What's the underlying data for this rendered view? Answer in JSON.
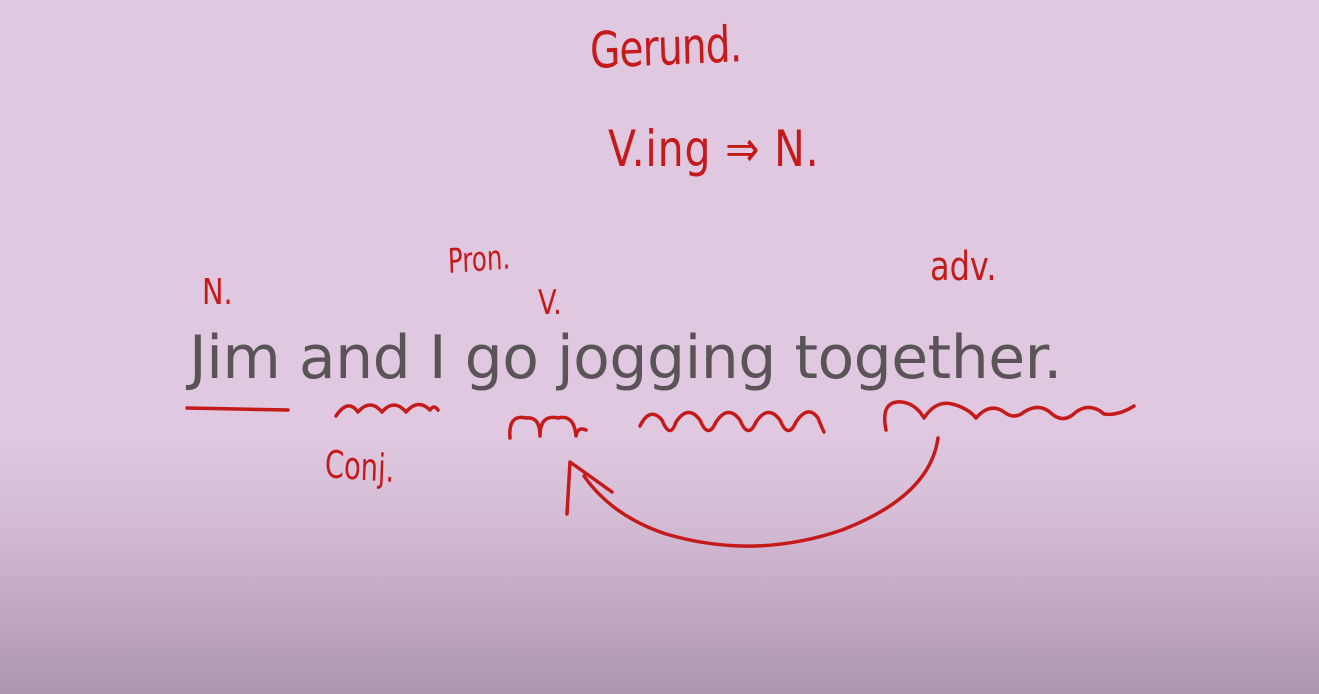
{
  "sentence": {
    "w1": "Jim",
    "w2": "and",
    "w3": "I",
    "w4": "go",
    "w5": "jogging",
    "w6": "together."
  },
  "annotations": {
    "title": "Gerund.",
    "rule": "V.ing ⇒ N.",
    "noun": "N.",
    "pronoun": "Pron.",
    "verb": "V.",
    "adverb": "adv.",
    "conjunction": "Conj."
  },
  "colors": {
    "background": "#e0c8e0",
    "text": "#5a5458",
    "ink": "#c41a1a"
  }
}
